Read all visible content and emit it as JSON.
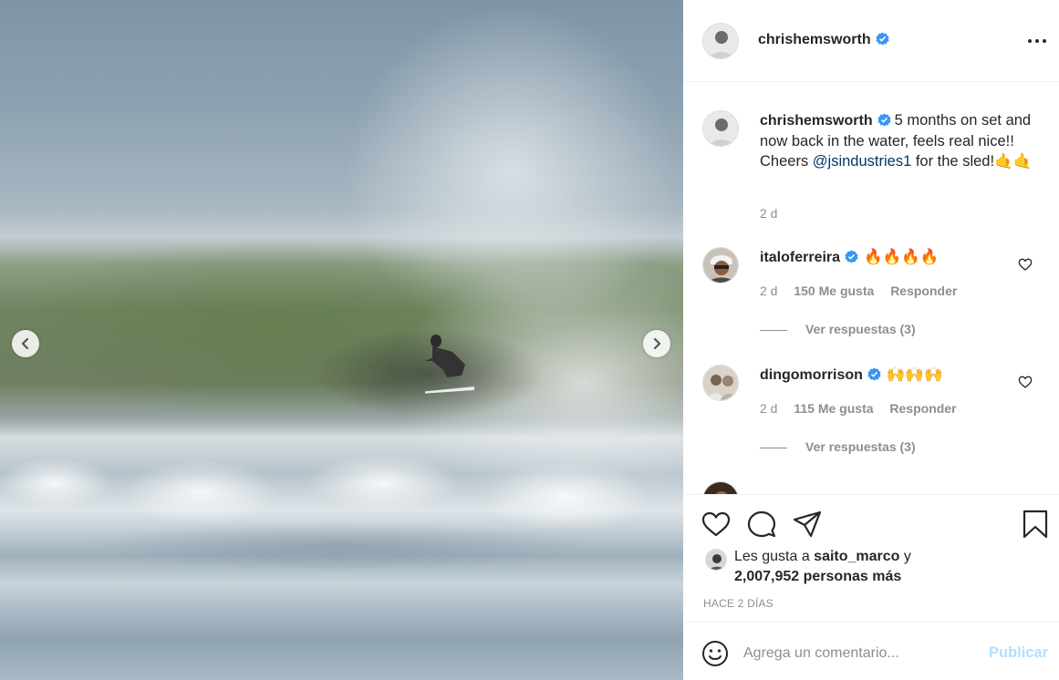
{
  "post": {
    "author": "chrishemsworth",
    "verified": true,
    "caption_text": "5 months on set and now back in the water, feels real nice!! Cheers ",
    "caption_mention": "@jsindustries1",
    "caption_tail": " for the sled!🤙🤙",
    "age": "2 d"
  },
  "comments": [
    {
      "username": "italoferreira",
      "text": "🔥🔥🔥🔥",
      "age": "2 d",
      "likes": "150 Me gusta",
      "reply_label": "Responder",
      "view_replies": "Ver respuestas (3)"
    },
    {
      "username": "dingomorrison",
      "text": "🙌🙌🙌",
      "age": "2 d",
      "likes": "115 Me gusta",
      "reply_label": "Responder",
      "view_replies": "Ver respuestas (3)"
    }
  ],
  "likes": {
    "prefix": "Les gusta a ",
    "first_user": "saito_marco",
    "connector": " y",
    "others": "2,007,952 personas más"
  },
  "timestamp": "HACE 2 DÍAS",
  "add_comment": {
    "placeholder": "Agrega un comentario...",
    "publish_label": "Publicar"
  },
  "colors": {
    "verified": "#3897f0",
    "publish_disabled": "#b2dffc",
    "mention": "#00376b",
    "secondary_text": "#8e8e8e"
  },
  "icons": [
    "chevron-left-icon",
    "chevron-right-icon",
    "more-icon",
    "heart-icon",
    "comment-icon",
    "share-icon",
    "bookmark-icon",
    "emoji-icon",
    "verified-badge-icon"
  ]
}
